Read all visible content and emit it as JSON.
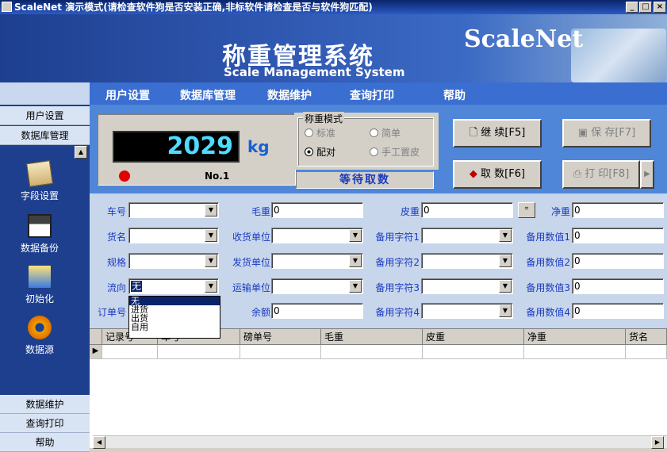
{
  "window": {
    "title": "ScaleNet 演示模式(请检查软件狗是否安装正确,非标软件请检查是否与软件狗匹配)",
    "min": "_",
    "max": "□",
    "close": "×"
  },
  "banner": {
    "title_cn": "称重管理系统",
    "title_en": "Scale Management System",
    "logo": "ScaleNet"
  },
  "menu": [
    "用户设置",
    "数据库管理",
    "数据维护",
    "查询打印",
    "帮助"
  ],
  "sidebar": {
    "top_items": [
      "用户设置",
      "数据库管理"
    ],
    "items": [
      {
        "label": "字段设置",
        "icon": "notepad-icon"
      },
      {
        "label": "数据备份",
        "icon": "floppy-icon"
      },
      {
        "label": "初始化",
        "icon": "folder-icon"
      },
      {
        "label": "数据源",
        "icon": "gear-icon"
      }
    ],
    "bottom_items": [
      "数据维护",
      "查询打印",
      "帮助"
    ]
  },
  "display": {
    "weight": "2029",
    "unit": "kg",
    "scale_no": "No.1",
    "status": "等待取数"
  },
  "mode": {
    "legend": "称重模式",
    "options": [
      {
        "label": "标准",
        "selected": false,
        "enabled": false
      },
      {
        "label": "简单",
        "selected": false,
        "enabled": false
      },
      {
        "label": "配对",
        "selected": true,
        "enabled": true
      },
      {
        "label": "手工置皮",
        "selected": false,
        "enabled": false
      }
    ]
  },
  "buttons": {
    "continue": "继 续[F5]",
    "save": "保 存[F7]",
    "fetch": "取 数[F6]",
    "print": "打 印[F8]"
  },
  "form": {
    "car_no": {
      "label": "车号",
      "value": ""
    },
    "gross": {
      "label": "毛重",
      "value": "0"
    },
    "tare": {
      "label": "皮重",
      "value": "0"
    },
    "net": {
      "label": "净重",
      "value": "0"
    },
    "goods": {
      "label": "货名",
      "value": ""
    },
    "receiver": {
      "label": "收货单位",
      "value": ""
    },
    "spare_str1": {
      "label": "备用字符1",
      "value": ""
    },
    "spare_num1": {
      "label": "备用数值1",
      "value": "0"
    },
    "spec": {
      "label": "规格",
      "value": ""
    },
    "sender": {
      "label": "发货单位",
      "value": ""
    },
    "spare_str2": {
      "label": "备用字符2",
      "value": ""
    },
    "spare_num2": {
      "label": "备用数值2",
      "value": "0"
    },
    "flow": {
      "label": "流向",
      "value": "无"
    },
    "transport": {
      "label": "运输单位",
      "value": ""
    },
    "spare_str3": {
      "label": "备用字符3",
      "value": ""
    },
    "spare_num3": {
      "label": "备用数值3",
      "value": "0"
    },
    "order_no": {
      "label": "订单号",
      "value": ""
    },
    "balance": {
      "label": "余额",
      "value": "0"
    },
    "spare_str4": {
      "label": "备用字符4",
      "value": ""
    },
    "spare_num4": {
      "label": "备用数值4",
      "value": "0"
    }
  },
  "flow_options": [
    "无",
    "进货",
    "出货",
    "自用"
  ],
  "grid": {
    "columns": [
      "记录号",
      "车号",
      "磅单号",
      "毛重",
      "皮重",
      "净重",
      "货名"
    ],
    "row_marker": "▶"
  }
}
